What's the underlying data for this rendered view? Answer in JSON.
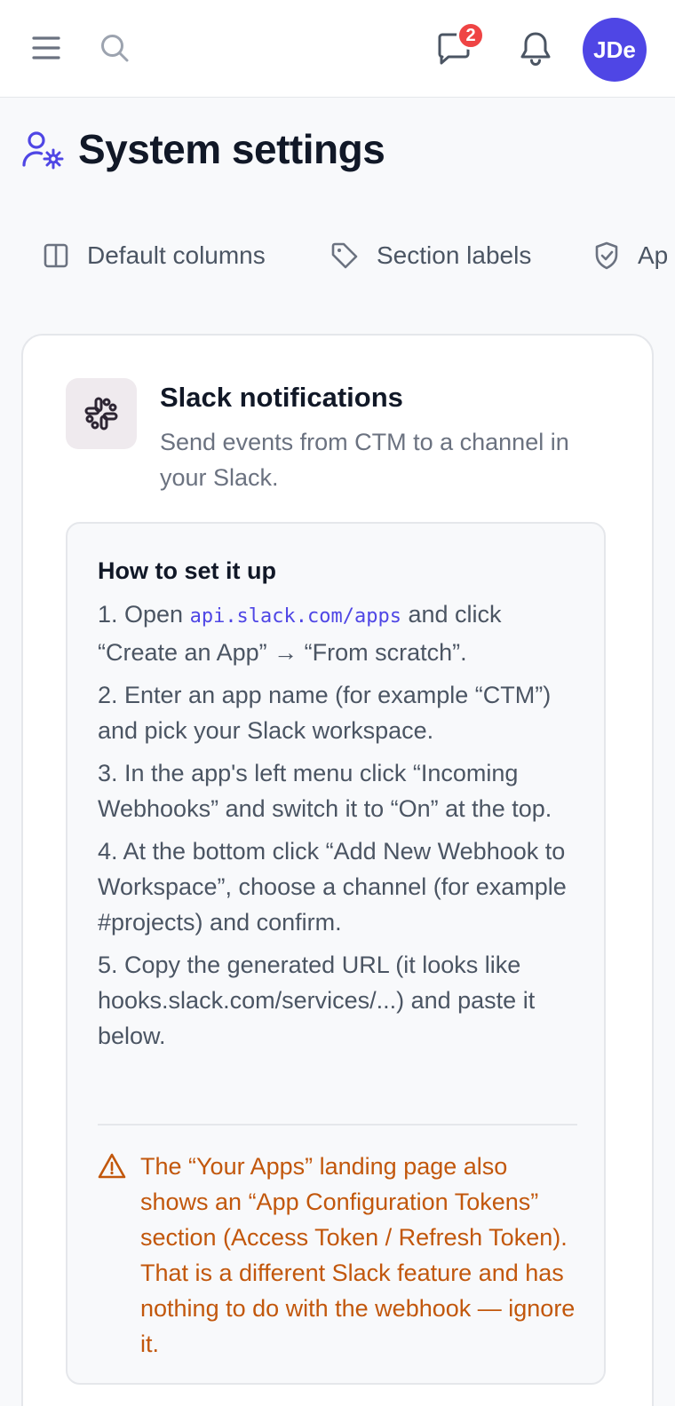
{
  "topbar": {
    "notification_count": "2",
    "avatar_initials": "JDe"
  },
  "page": {
    "title": "System settings"
  },
  "tabs": [
    {
      "label": "Default columns",
      "icon": "columns-icon"
    },
    {
      "label": "Section labels",
      "icon": "tag-icon"
    },
    {
      "label": "Ap",
      "icon": "shield-check-icon"
    }
  ],
  "card": {
    "title": "Slack notifications",
    "description": "Send events from CTM to a channel in your Slack.",
    "howto_title": "How to set it up",
    "steps": {
      "s1_prefix": "1. Open ",
      "s1_code": "api.slack.com/apps",
      "s1_suffix": " and click “Create an App” → “From scratch”.",
      "s2": "2. Enter an app name (for example “CTM”) and pick your Slack workspace.",
      "s3": "3. In the app's left menu click “Incoming Webhooks” and switch it to “On” at the top.",
      "s4": "4. At the bottom click “Add New Webhook to Workspace”, choose a channel (for example #projects) and confirm.",
      "s5": "5. Copy the generated URL (it looks like hooks.slack.com/services/...) and paste it below."
    },
    "warning": "The “Your Apps” landing page also shows an “App Configuration Tokens” section (Access Token / Refresh Token). That is a different Slack feature and has nothing to do with the webhook — ignore it."
  },
  "colors": {
    "accent": "#4f46e5",
    "badge": "#ef4444",
    "warning": "#c2570c"
  }
}
